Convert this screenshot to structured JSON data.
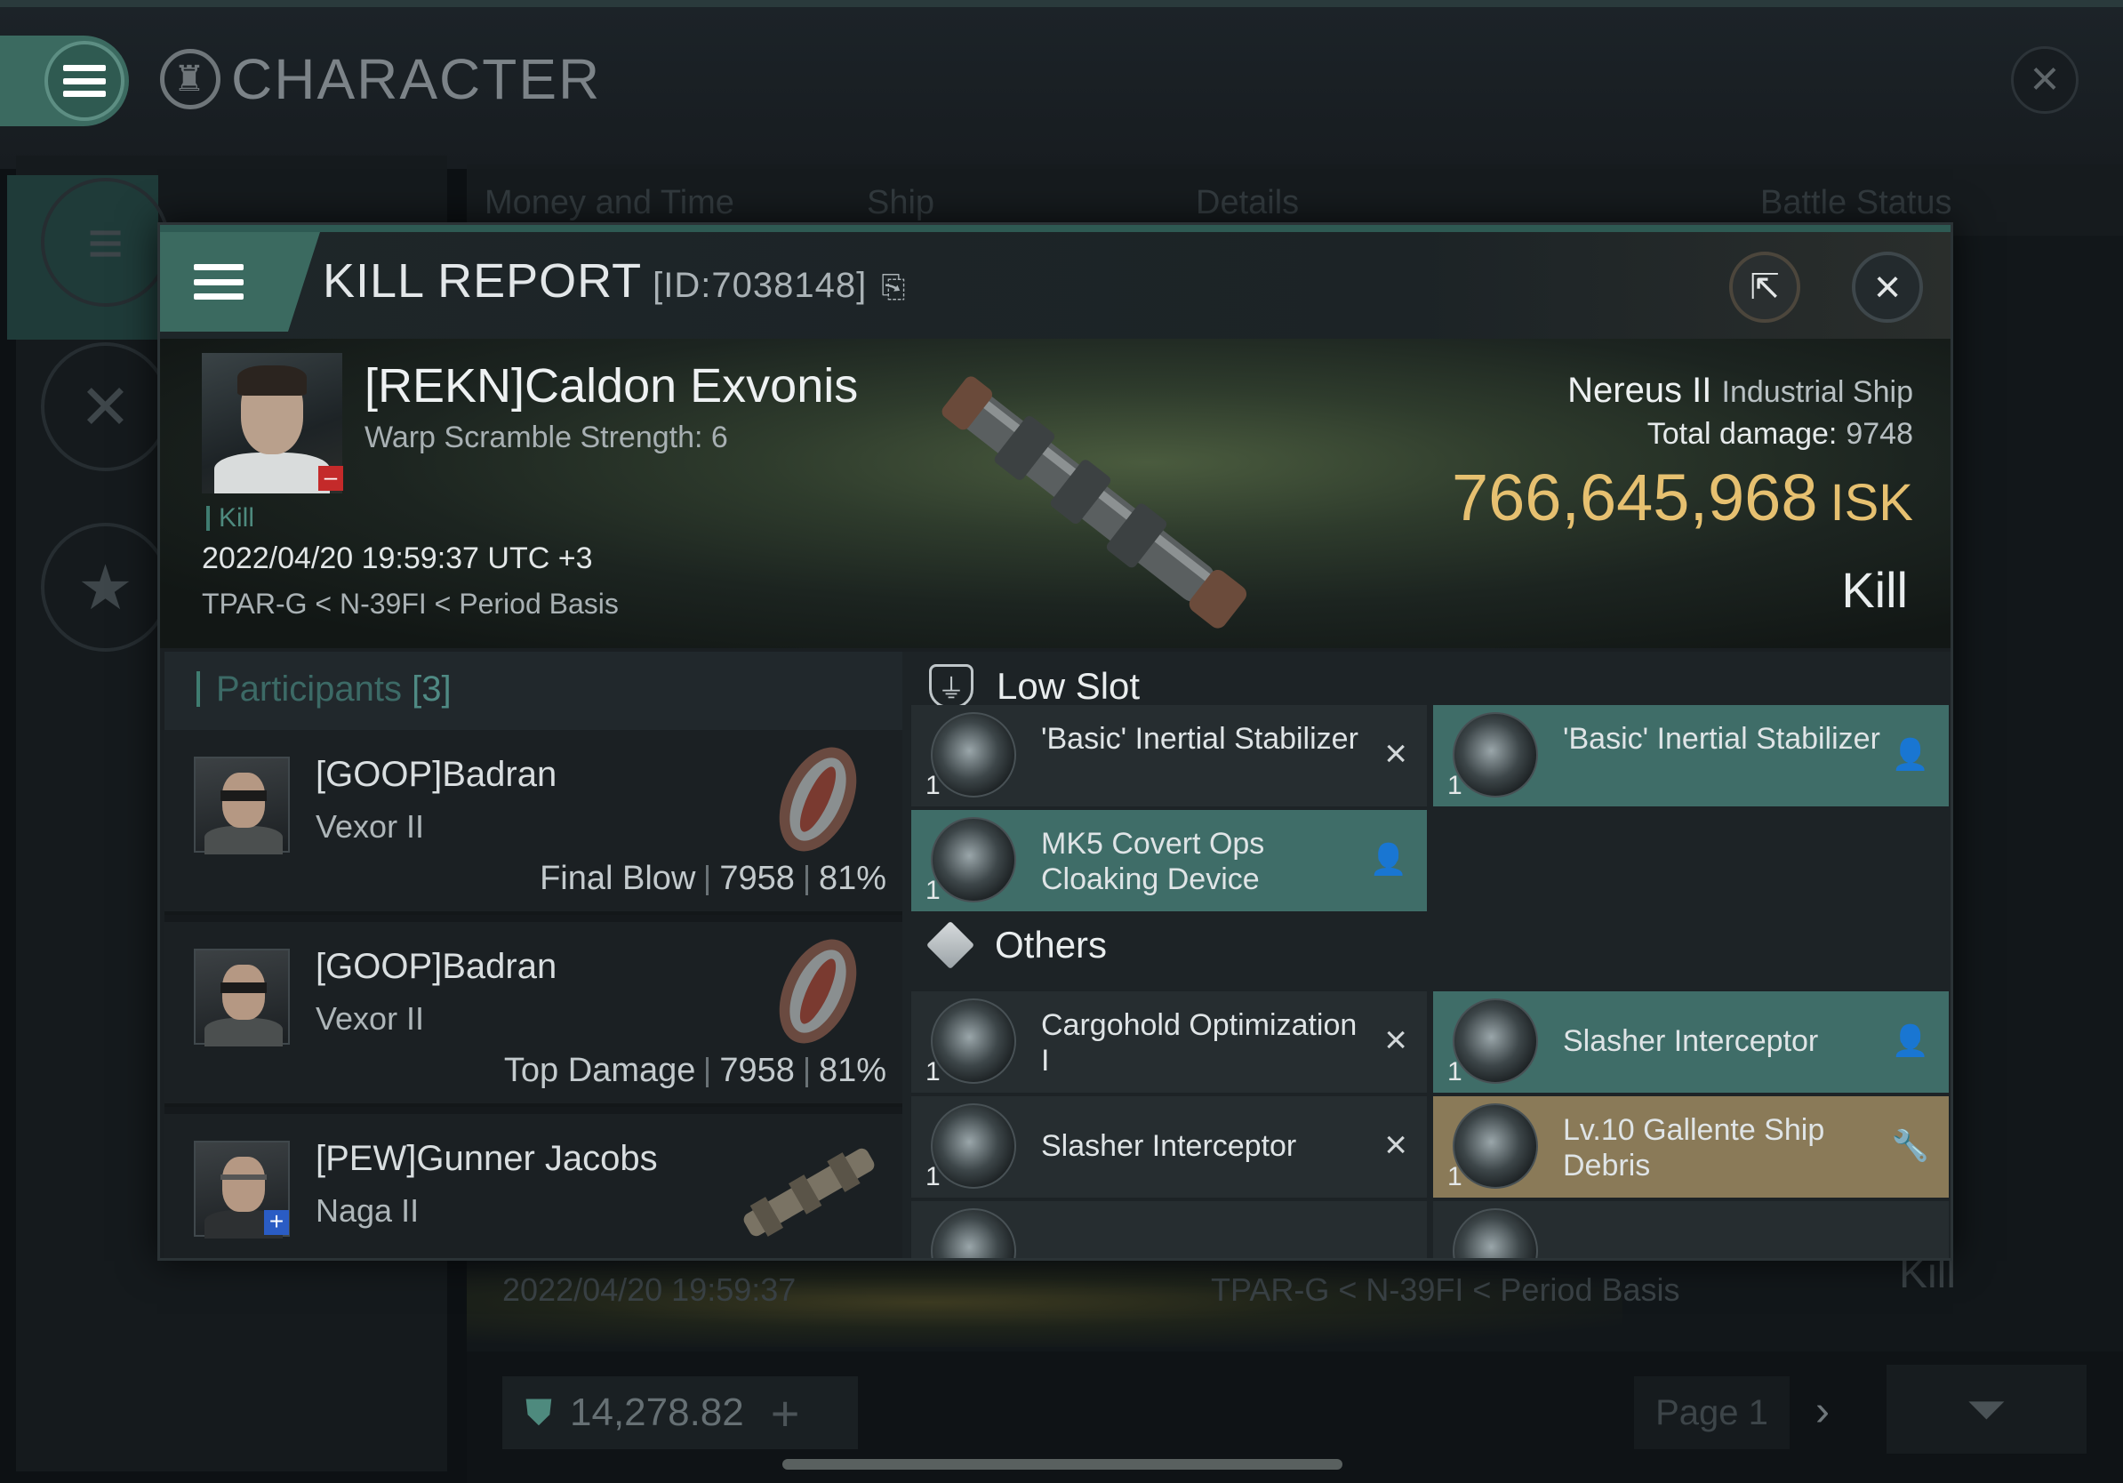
{
  "app": {
    "title": "CHARACTER"
  },
  "background": {
    "columns": [
      "Money and Time",
      "Ship",
      "Details",
      "Battle Status"
    ],
    "row_time": "2022/04/20 19:59:37",
    "row_location": "TPAR-G < N-39FI < Period Basis",
    "row_status": "Kill",
    "balance": "14,278.82",
    "page": "Page 1"
  },
  "modal": {
    "title": "KILL REPORT",
    "id_label": "[ID:7038148]",
    "victim": {
      "name": "[REKN]Caldon Exvonis",
      "warp_scramble": "Warp Scramble Strength: 6",
      "tag": "Kill",
      "time": "2022/04/20 19:59:37 UTC +3",
      "location": "TPAR-G < N-39FI < Period Basis"
    },
    "ship": {
      "name": "Nereus II",
      "class": "Industrial Ship",
      "total_damage_label": "Total damage:",
      "total_damage": "9748",
      "isk_value": "766,645,968",
      "isk_unit": "ISK",
      "result": "Kill"
    },
    "participants": {
      "label": "Participants",
      "count": "[3]",
      "rows": [
        {
          "name": "[GOOP]Badran",
          "ship": "Vexor II",
          "role": "Final Blow",
          "damage": "7958",
          "percent": "81%"
        },
        {
          "name": "[GOOP]Badran",
          "ship": "Vexor II",
          "role": "Top Damage",
          "damage": "7958",
          "percent": "81%"
        },
        {
          "name": "[PEW]Gunner Jacobs",
          "ship": "Naga II",
          "role": "",
          "damage": "",
          "percent": ""
        }
      ]
    },
    "low_slot": {
      "title": "Low Slot",
      "items": [
        {
          "name": "'Basic' Inertial Stabilizer",
          "qty": "1",
          "status": "destroyed"
        },
        {
          "name": "'Basic' Inertial Stabilizer",
          "qty": "1",
          "status": "dropped"
        },
        {
          "name": "MK5 Covert Ops Cloaking Device",
          "qty": "1",
          "status": "dropped"
        }
      ]
    },
    "others": {
      "title": "Others",
      "items": [
        {
          "name": "Cargohold Optimization I",
          "qty": "1",
          "status": "destroyed"
        },
        {
          "name": "Slasher Interceptor",
          "qty": "1",
          "status": "dropped"
        },
        {
          "name": "Slasher Interceptor",
          "qty": "1",
          "status": "destroyed"
        },
        {
          "name": "Lv.10 Gallente Ship Debris",
          "qty": "1",
          "status": "salvage"
        }
      ]
    }
  },
  "colors": {
    "accent": "#3b6a60",
    "isk": "#e6c070",
    "dropped": "#3f6d68",
    "salvage": "#8a7a58"
  }
}
